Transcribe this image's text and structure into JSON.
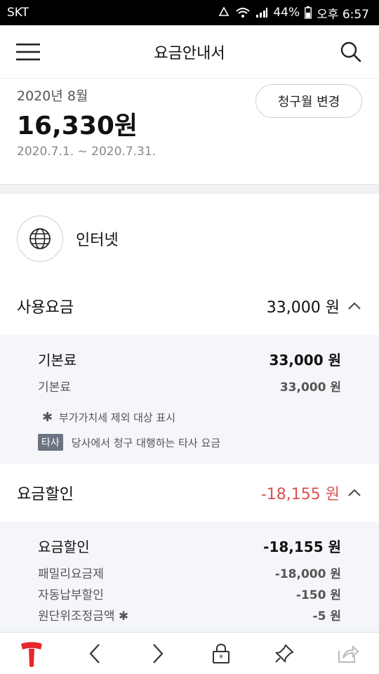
{
  "status_bar": {
    "carrier": "SKT",
    "battery_percent": "44%",
    "time": "오후 6:57"
  },
  "header": {
    "title": "요금안내서",
    "menu_icon": "hamburger-menu-icon",
    "search_icon": "search-icon"
  },
  "summary": {
    "month": "2020년 8월",
    "amount": "16,330원",
    "period": "2020.7.1. ~ 2020.7.31.",
    "change_month_label": "청구월 변경"
  },
  "service": {
    "icon": "globe-icon",
    "name": "인터넷"
  },
  "usage": {
    "label": "사용요금",
    "value": "33,000 원",
    "details": {
      "main_label": "기본료",
      "main_value": "33,000 원",
      "sub_label": "기본료",
      "sub_value": "33,000 원"
    },
    "note_vat": "부가가치세 제외 대상 표시",
    "note_star": "✱",
    "tag_label": "타사",
    "note_tag": "당사에서 청구 대행하는 타사 요금"
  },
  "discount": {
    "label": "요금할인",
    "value": "-18,155 원",
    "details": {
      "main_label": "요금할인",
      "main_value": "-18,155 원",
      "rows": [
        {
          "label": "패밀리요금제",
          "value": "-18,000 원"
        },
        {
          "label": "자동납부할인",
          "value": "-150 원"
        },
        {
          "label": "원단위조정금액 ✱",
          "value": "-5 원"
        }
      ]
    }
  },
  "bottom_nav": {
    "items": [
      "t-logo-icon",
      "back-icon",
      "forward-icon",
      "lock-icon",
      "pin-icon",
      "share-icon"
    ]
  },
  "colors": {
    "negative": "#d9534f",
    "detail_background": "#f4f6f9",
    "brand_red": "#e8262d"
  }
}
